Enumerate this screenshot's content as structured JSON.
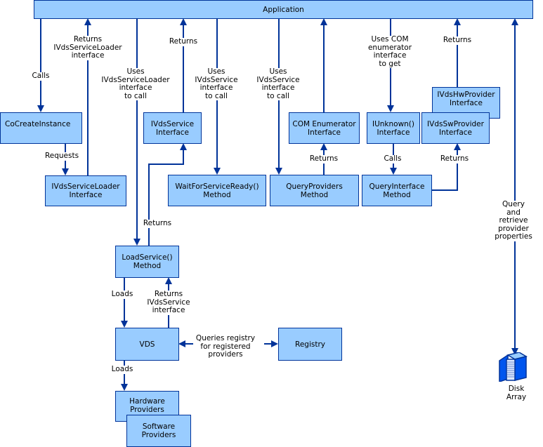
{
  "colors": {
    "box_fill": "#99ccff",
    "box_border": "#003399",
    "line": "#003399"
  },
  "boxes": {
    "application": "Application",
    "cocreate": "CoCreateInstance",
    "loader": "IVdsServiceLoader\nInterface",
    "service": "IVdsService\nInterface",
    "wait": "WaitForServiceReady()\nMethod",
    "com_enum": "COM Enumerator\nInterface",
    "query_providers": "QueryProviders\nMethod",
    "iunknown": "IUnknown()\nInterface",
    "query_interface": "QueryInterface\nMethod",
    "hw_provider": "IVdsHwProvider\nInterface",
    "sw_provider": "IVdsSwProvider\nInterface",
    "load_service": "LoadService()\nMethod",
    "vds": "VDS",
    "registry": "Registry",
    "hardware": "Hardware\nProviders",
    "software": "Software\nProviders"
  },
  "labels": {
    "calls": "Calls",
    "returns_loader": "Returns\nIVdsServiceLoader\ninterface",
    "uses_loader": "Uses\nIVdsServiceLoader\ninterface\nto call",
    "returns_service": "Returns",
    "uses_service_wait": "Uses\nIVdsService\ninterface\nto call",
    "uses_service_query": "Uses\nIVdsService\ninterface\nto call",
    "uses_com": "Uses COM\nenumerator\ninterface\nto get",
    "returns_hw": "Returns",
    "requests": "Requests",
    "returns_com": "Returns",
    "calls_qi": "Calls",
    "returns_sw": "Returns",
    "returns_load": "Returns",
    "loads_vds": "Loads",
    "returns_ivds": "Returns\nIVdsService\ninterface",
    "queries_registry": "Queries registry\nfor registered\nproviders",
    "loads_providers": "Loads",
    "query_retrieve": "Query and\nretrieve provider\nproperties",
    "disk_array": "Disk Array"
  },
  "icons": {
    "disk_array": "server-icon"
  }
}
